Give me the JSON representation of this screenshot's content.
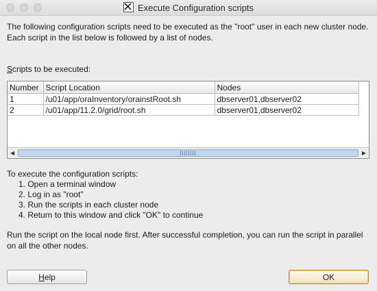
{
  "window": {
    "title": "Execute Configuration scripts"
  },
  "intro": "The following configuration scripts need to be executed as the \"root\" user in each new cluster node. Each script in the list below is followed by a list of nodes.",
  "scripts_label": {
    "mnemonic": "S",
    "rest": "cripts to be executed:"
  },
  "table": {
    "headers": {
      "number": "Number",
      "location": "Script Location",
      "nodes": "Nodes"
    },
    "rows": [
      {
        "number": "1",
        "location": "/u01/app/oraInventory/orainstRoot.sh",
        "nodes": "dbserver01,dbserver02"
      },
      {
        "number": "2",
        "location": "/u01/app/11.2.0/grid/root.sh",
        "nodes": "dbserver01,dbserver02"
      }
    ]
  },
  "instructions": {
    "heading": "To execute the configuration scripts:",
    "steps": [
      "1. Open a terminal window",
      "2. Log in as \"root\"",
      "3. Run the scripts in each cluster node",
      "4. Return to this window and click \"OK\" to continue"
    ]
  },
  "note": "Run the script on the local node first. After successful completion, you can run the script in parallel on all the other nodes.",
  "buttons": {
    "help_mnemonic": "H",
    "help_rest": "elp",
    "ok": "OK"
  },
  "icons": {
    "title": "x11-icon",
    "scroll_left": "arrow-left-icon",
    "scroll_right": "arrow-right-icon"
  }
}
